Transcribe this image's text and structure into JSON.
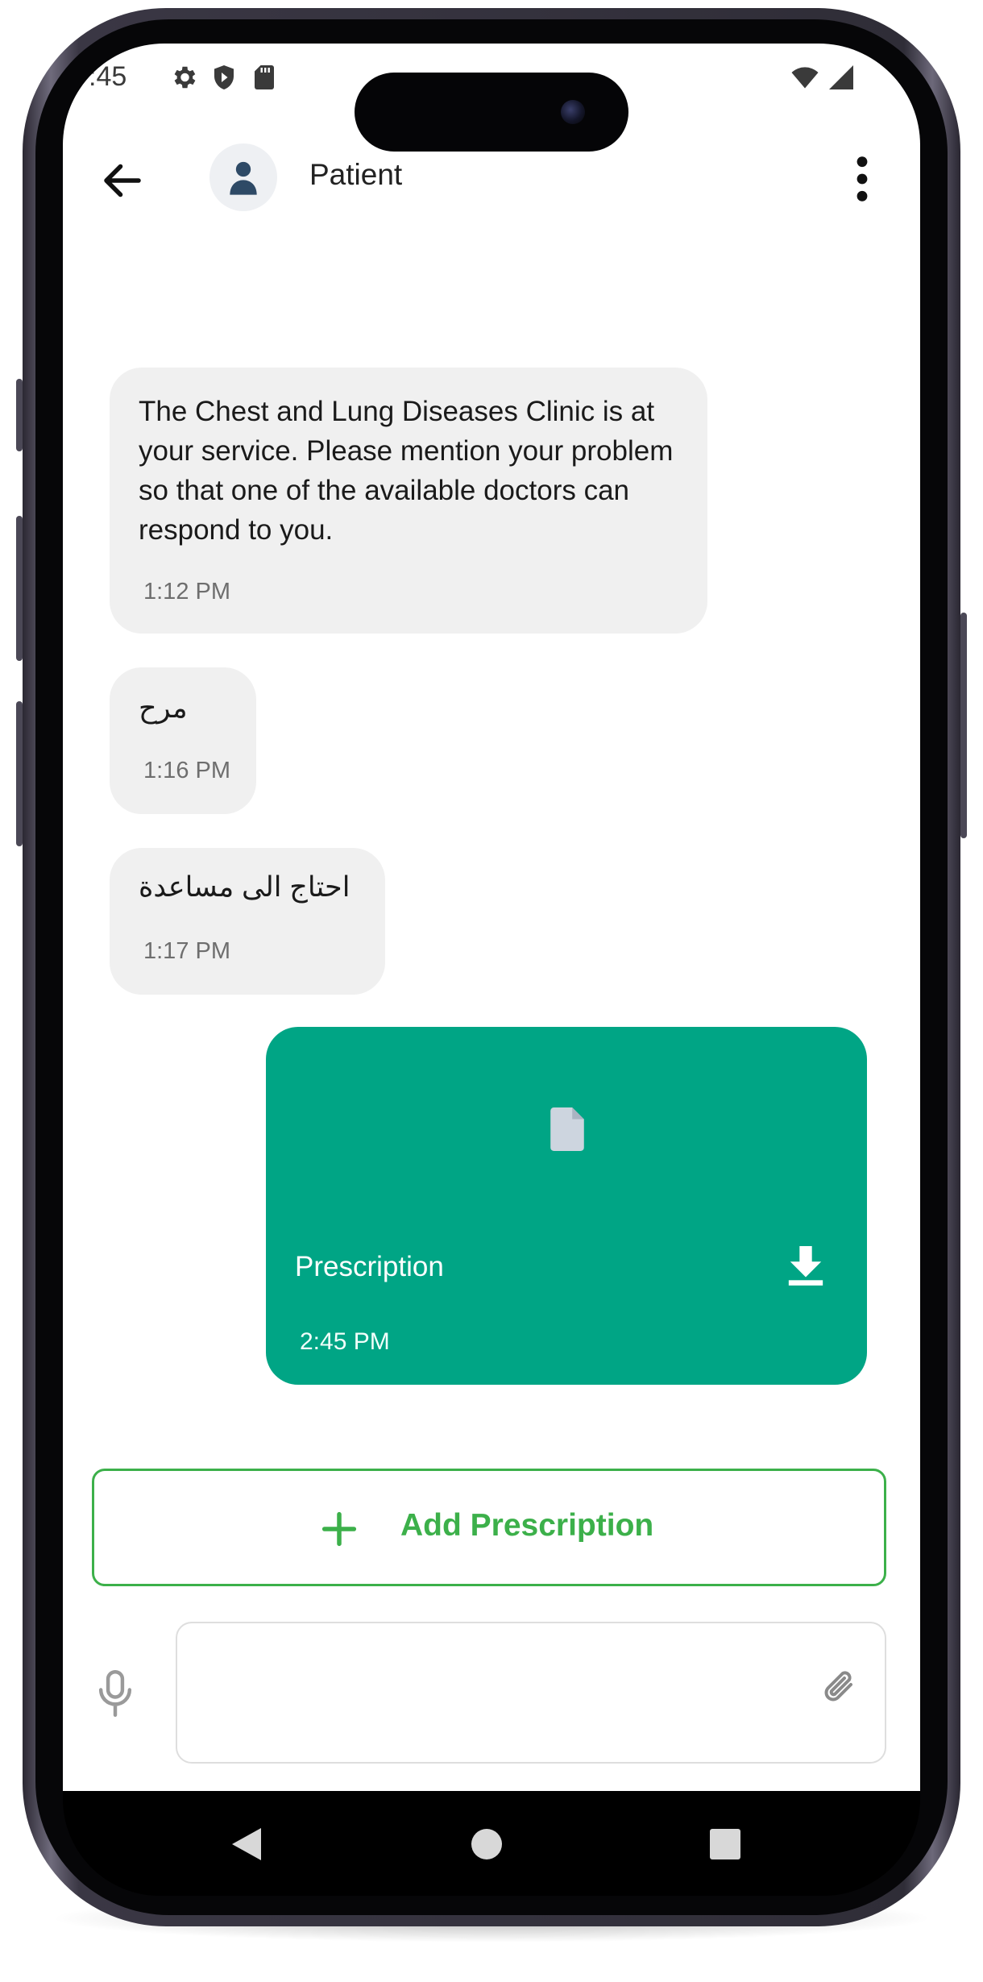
{
  "status_bar": {
    "time": ":45"
  },
  "header": {
    "title": "Patient"
  },
  "messages": [
    {
      "text": "The Chest and Lung Diseases Clinic is at your service. Please mention your problem so that one of the available doctors can respond to you.",
      "time": "1:12 PM"
    },
    {
      "text": "مرح",
      "time": "1:16 PM"
    },
    {
      "text": "احتاج الى مساعدة",
      "time": "1:17 PM"
    }
  ],
  "attachment": {
    "name": "Prescription",
    "time": "2:45 PM"
  },
  "actions": {
    "add_prescription_label": "Add Prescription"
  },
  "composer": {
    "value": "",
    "placeholder": ""
  },
  "colors": {
    "accent_green": "#3cb04a",
    "attachment_bg": "#00a585",
    "bubble_bg": "#f0f0f0"
  },
  "icons": [
    "back-arrow-icon",
    "person-icon",
    "more-vert-icon",
    "document-icon",
    "download-icon",
    "plus-icon",
    "mic-icon",
    "paperclip-icon",
    "gear-icon",
    "shield-icon",
    "sd-card-icon",
    "wifi-icon",
    "signal-icon"
  ]
}
